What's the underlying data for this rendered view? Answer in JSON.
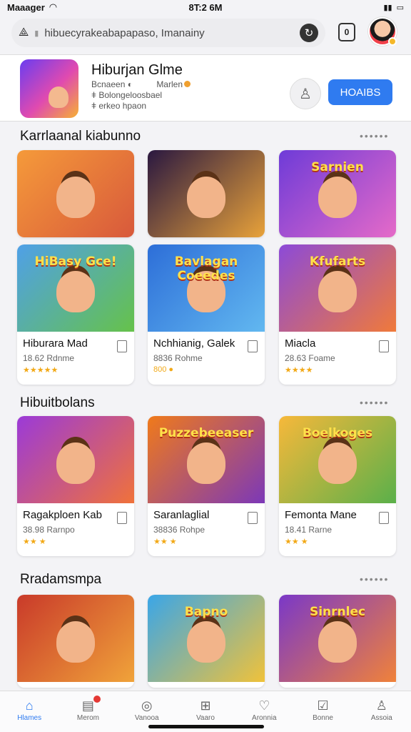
{
  "status_bar": {
    "carrier": "Maaager",
    "time": "8T:2 6M",
    "icons": [
      "wifi-icon",
      "battery-icon"
    ]
  },
  "address_bar": {
    "url": "hibuecyrakeabapapaso, Imanainy",
    "tab_count": "0"
  },
  "app_header": {
    "title": "Hiburjan Glme",
    "meta_line1_a": "Bcnaeen",
    "meta_line1_b": "Marlen",
    "meta_line2": "Bolongeloosbael",
    "meta_line3": "erkeo hpaon",
    "button_label": "HOAIBS"
  },
  "sections": [
    {
      "title": "Karrlaanal kiabunno",
      "cards": [
        {
          "name": "",
          "sub": "",
          "rating": "",
          "thumb": [
            "#f59a3a",
            "#d8593b"
          ],
          "label": ""
        },
        {
          "name": "",
          "sub": "",
          "rating": "",
          "thumb": [
            "#2a1840",
            "#e8a23a"
          ],
          "label": ""
        },
        {
          "name": "",
          "sub": "",
          "rating": "",
          "thumb": [
            "#6e3bd8",
            "#e56ac8"
          ],
          "label": "Sarnien"
        },
        {
          "name": "Hiburara Mad",
          "sub": "18.62 Rdnme",
          "rating": "★★★★★",
          "thumb": [
            "#4fa0e8",
            "#66c24a"
          ],
          "label": "HiBasy Gce!"
        },
        {
          "name": "Nchhianig, Galek",
          "sub": "8836 Rohme",
          "rating": "800 ●",
          "thumb": [
            "#2d6ed8",
            "#62b8f0"
          ],
          "label": "Bavlagan Coeedes"
        },
        {
          "name": "Miacla",
          "sub": "28.63 Foame",
          "rating": "★★★★",
          "thumb": [
            "#8c4ad8",
            "#f07a3a"
          ],
          "label": "Kfufarts"
        }
      ]
    },
    {
      "title": "Hibuitbolans",
      "cards": [
        {
          "name": "Ragakploen Kab",
          "sub": "38.98 Rarnpo",
          "rating": "★★ ★",
          "thumb": [
            "#9b3ad8",
            "#f0723a"
          ],
          "label": ""
        },
        {
          "name": "Saranlaglial",
          "sub": "38836 Rohpe",
          "rating": "★★ ★",
          "thumb": [
            "#f07a1a",
            "#7c38b8"
          ],
          "label": "Puzzebeeaser"
        },
        {
          "name": "Femonta Mane",
          "sub": "18.41 Rarne",
          "rating": "★★ ★",
          "thumb": [
            "#f7b83a",
            "#5ab04a"
          ],
          "label": "Boelkoges"
        }
      ]
    },
    {
      "title": "Rradamsmpa",
      "cards": [
        {
          "thumb": [
            "#c93a2a",
            "#f0a33a"
          ],
          "label": ""
        },
        {
          "thumb": [
            "#3aa6e8",
            "#f0c23a"
          ],
          "label": "Bapno"
        },
        {
          "thumb": [
            "#7a38c8",
            "#f0823a"
          ],
          "label": "Sinrnlec"
        }
      ]
    }
  ],
  "nav": [
    {
      "label": "Hlames",
      "icon": "home-icon",
      "active": true
    },
    {
      "label": "Merom",
      "icon": "inbox-icon",
      "badge": true
    },
    {
      "label": "Vanooa",
      "icon": "compass-icon"
    },
    {
      "label": "Vaaro",
      "icon": "plus-box-icon"
    },
    {
      "label": "Aronnia",
      "icon": "heart-icon"
    },
    {
      "label": "Bonne",
      "icon": "check-box-icon"
    },
    {
      "label": "Assoia",
      "icon": "person-icon"
    }
  ]
}
